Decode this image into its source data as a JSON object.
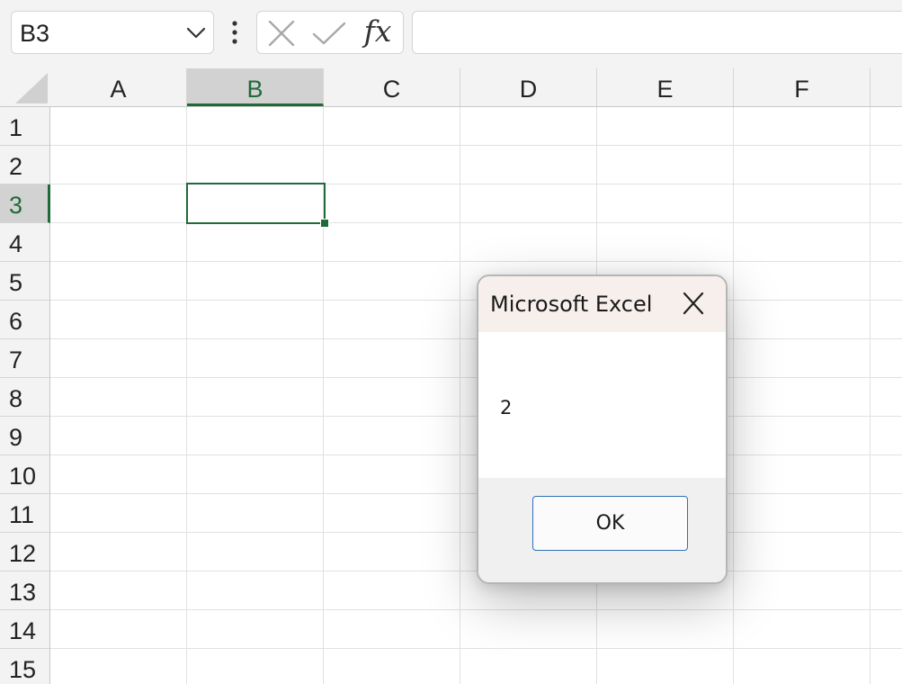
{
  "formula_bar": {
    "name_box": "B3",
    "insert_function_label": "fx",
    "formula_value": ""
  },
  "grid": {
    "columns": [
      "A",
      "B",
      "C",
      "D",
      "E",
      "F"
    ],
    "rows": [
      "1",
      "2",
      "3",
      "4",
      "5",
      "6",
      "7",
      "8",
      "9",
      "10",
      "11",
      "12",
      "13",
      "14",
      "15"
    ],
    "active_column": "B",
    "active_row": "3",
    "selection_color": "#1e6b38"
  },
  "dialog": {
    "title": "Microsoft Excel",
    "message": "2",
    "ok_label": "OK"
  },
  "icons": {
    "name_box_dropdown": "chevron-down-icon",
    "formula_options": "vertical-ellipsis-icon",
    "cancel": "close-icon",
    "enter": "check-icon",
    "dialog_close": "close-icon"
  }
}
